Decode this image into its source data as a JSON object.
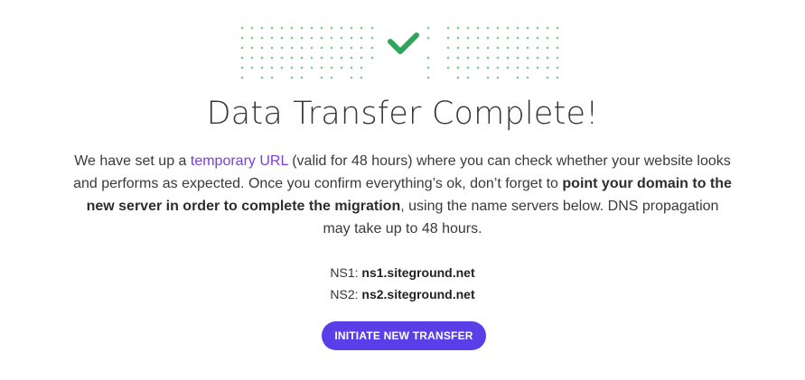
{
  "success_icon": "checkmark-icon",
  "decor": "dot-grid-pattern",
  "colors": {
    "check": "#2ea65a",
    "dots": "#7cc98d",
    "link": "#7a3fd6",
    "button": "#5a3fe8"
  },
  "title": "Data Transfer Complete!",
  "description": {
    "part1": "We have set up a ",
    "link_text": "temporary URL",
    "part2": " (valid for 48 hours) where you can check whether your website looks and performs as expected. Once you confirm everything’s ok, don’t forget to ",
    "bold_text": "point your domain to the new server in order to complete the migration",
    "part3": ", using the name servers below. DNS propagation may take up to 48 hours."
  },
  "nameservers": [
    {
      "label": "NS1: ",
      "value": "ns1.siteground.net"
    },
    {
      "label": "NS2: ",
      "value": "ns2.siteground.net"
    }
  ],
  "button_label": "INITIATE NEW TRANSFER"
}
